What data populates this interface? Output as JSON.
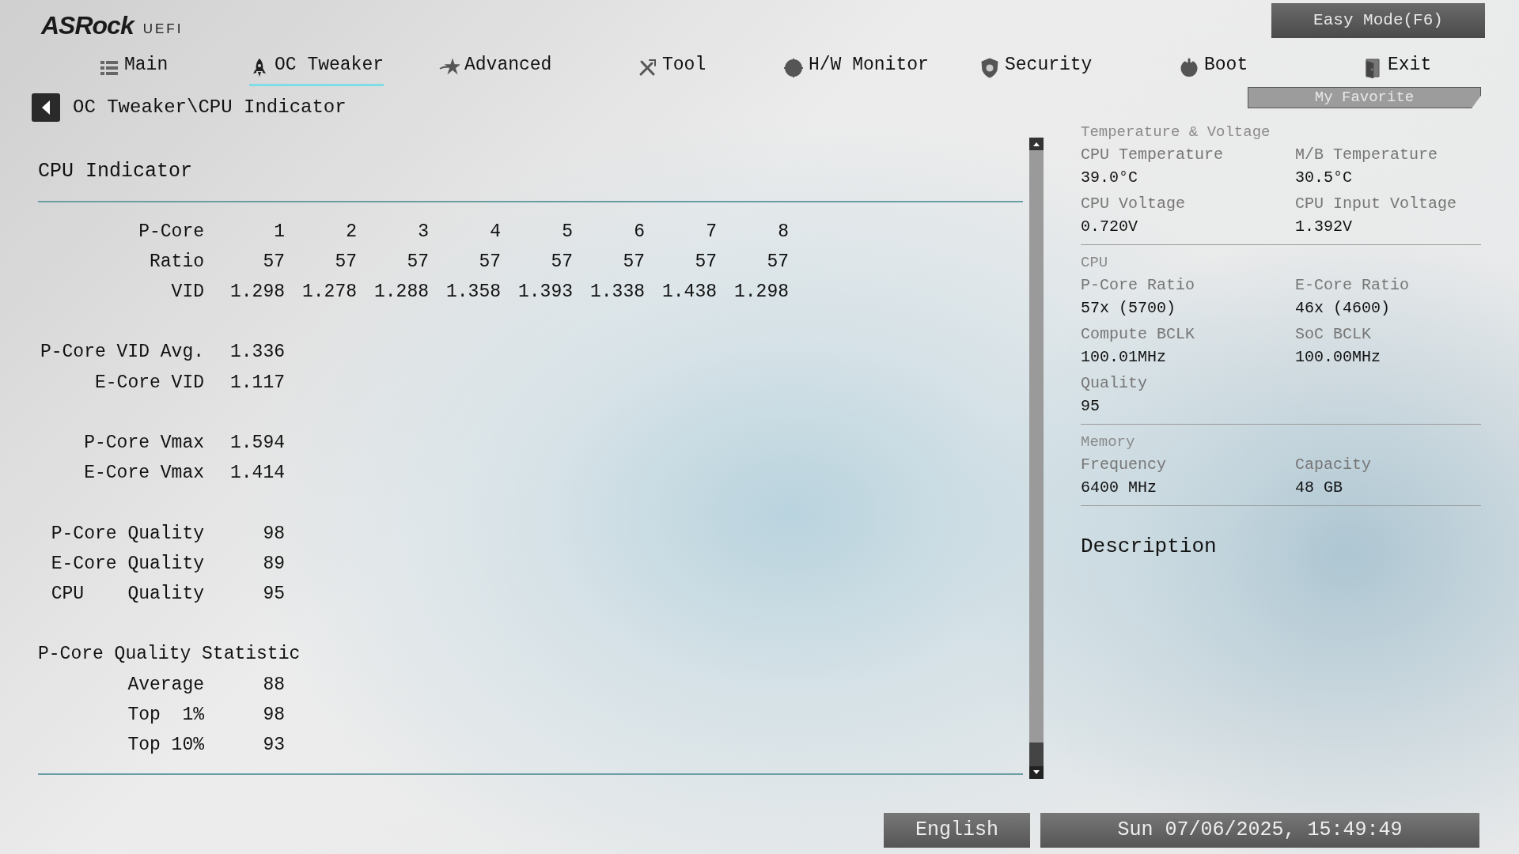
{
  "logo": {
    "brand": "ASRock",
    "sub": "UEFI"
  },
  "mode_button": "Easy Mode(F6)",
  "tabs": [
    {
      "label": "Main",
      "selected": false
    },
    {
      "label": "OC Tweaker",
      "selected": true
    },
    {
      "label": "Advanced",
      "selected": false
    },
    {
      "label": "Tool",
      "selected": false
    },
    {
      "label": "H/W Monitor",
      "selected": false
    },
    {
      "label": "Security",
      "selected": false
    },
    {
      "label": "Boot",
      "selected": false
    },
    {
      "label": "Exit",
      "selected": false
    }
  ],
  "breadcrumb": "OC Tweaker\\CPU Indicator",
  "favorite_button": "My Favorite",
  "indicator": {
    "title": "CPU Indicator",
    "groups": [
      [
        {
          "kind": "values",
          "label": "P-Core",
          "values": [
            "1",
            "2",
            "3",
            "4",
            "5",
            "6",
            "7",
            "8"
          ]
        },
        {
          "kind": "values",
          "label": "Ratio",
          "values": [
            "57",
            "57",
            "57",
            "57",
            "57",
            "57",
            "57",
            "57"
          ]
        },
        {
          "kind": "values",
          "label": "VID",
          "values": [
            "1.298",
            "1.278",
            "1.288",
            "1.358",
            "1.393",
            "1.338",
            "1.438",
            "1.298"
          ]
        }
      ],
      [
        {
          "kind": "values",
          "label": "P-Core VID Avg.",
          "values": [
            "1.336"
          ]
        },
        {
          "kind": "values",
          "label": "E-Core VID",
          "values": [
            "1.117"
          ]
        }
      ],
      [
        {
          "kind": "values",
          "label": "P-Core Vmax",
          "values": [
            "1.594"
          ]
        },
        {
          "kind": "values",
          "label": "E-Core Vmax",
          "values": [
            "1.414"
          ]
        }
      ],
      [
        {
          "kind": "values",
          "label": "P-Core Quality",
          "values": [
            "98"
          ]
        },
        {
          "kind": "values",
          "label": "E-Core Quality",
          "values": [
            "89"
          ]
        },
        {
          "kind": "values",
          "label": "CPU    Quality",
          "values": [
            "95"
          ]
        }
      ],
      [
        {
          "kind": "heading",
          "label": "P-Core Quality Statistic"
        },
        {
          "kind": "values",
          "label": "Average",
          "values": [
            "88"
          ]
        },
        {
          "kind": "values",
          "label": "Top  1%",
          "values": [
            "98"
          ]
        },
        {
          "kind": "values",
          "label": "Top 10%",
          "values": [
            "93"
          ]
        }
      ]
    ]
  },
  "info_panel": {
    "sections": [
      {
        "caption": "Temperature & Voltage",
        "items": [
          {
            "label": "CPU Temperature",
            "value": "39.0°C"
          },
          {
            "label": "M/B Temperature",
            "value": "30.5°C"
          },
          {
            "label": "CPU Voltage",
            "value": "0.720V"
          },
          {
            "label": "CPU Input Voltage",
            "value": "1.392V"
          }
        ]
      },
      {
        "caption": "CPU",
        "items": [
          {
            "label": "P-Core Ratio",
            "value": "57x (5700)"
          },
          {
            "label": "E-Core Ratio",
            "value": "46x (4600)"
          },
          {
            "label": "Compute BCLK",
            "value": "100.01MHz"
          },
          {
            "label": "SoC BCLK",
            "value": "100.00MHz"
          },
          {
            "label": "Quality",
            "value": "95"
          }
        ]
      },
      {
        "caption": "Memory",
        "items": [
          {
            "label": "Frequency",
            "value": "6400 MHz"
          },
          {
            "label": "Capacity",
            "value": "48 GB"
          }
        ]
      }
    ],
    "description_title": "Description"
  },
  "footer": {
    "language": "English",
    "datetime": "Sun 07/06/2025, 15:49:49"
  }
}
